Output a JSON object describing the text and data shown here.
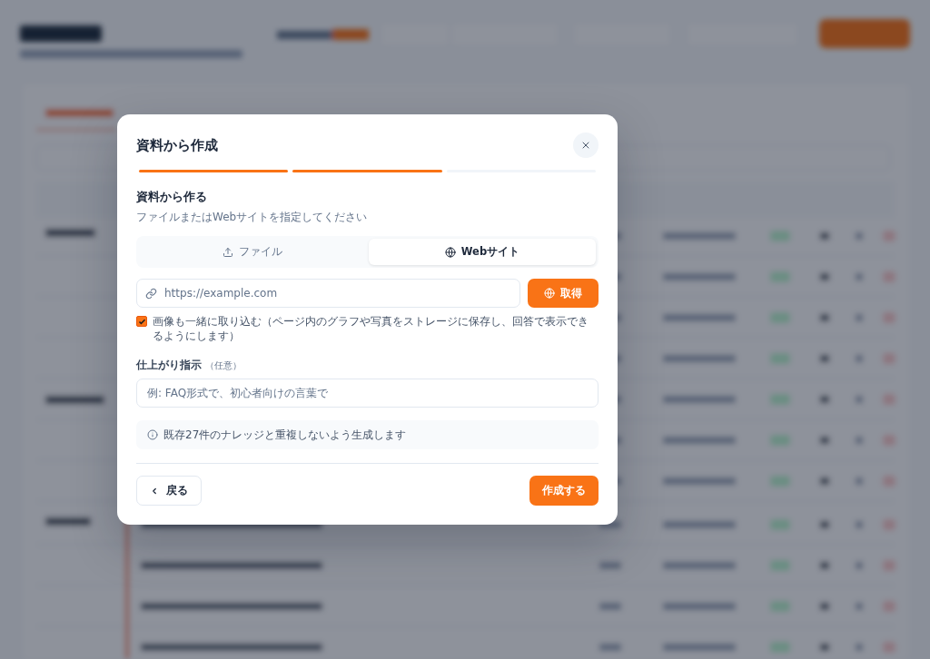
{
  "dialog": {
    "title": "資料から作成",
    "steps": [
      {
        "done": true
      },
      {
        "done": true
      },
      {
        "done": false
      }
    ],
    "heading": "資料から作る",
    "subtitle": "ファイルまたはWebサイトを指定してください",
    "tabs": [
      {
        "label": "ファイル",
        "selected": false,
        "kind": "file"
      },
      {
        "label": "Webサイト",
        "selected": true,
        "kind": "website"
      }
    ],
    "url_field": {
      "placeholder": "https://example.com"
    },
    "fetch_button": "取得",
    "include_images": {
      "label": "画像も一緒に取り込む（ページ内のグラフや写真をストレージに保存し、回答で表示できるようにします）",
      "checked": true
    },
    "instructions": {
      "label": "仕上がり指示",
      "optional": "（任意）",
      "placeholder": "例: FAQ形式で、初心者向けの言葉で"
    },
    "notice": "既存27件のナレッジと重複しないよう生成します",
    "back_button": "戻る",
    "submit_button": "作成する"
  }
}
